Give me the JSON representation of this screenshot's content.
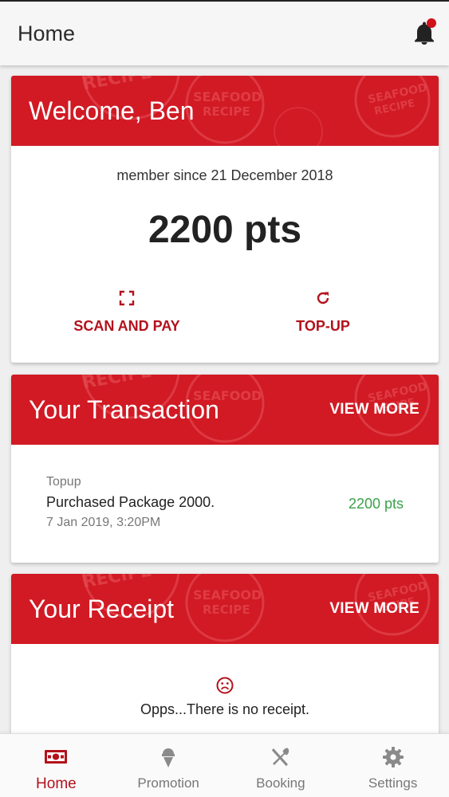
{
  "header": {
    "title": "Home",
    "bell_icon": "bell-icon",
    "notification_dot_color": "#d0111b"
  },
  "brand": {
    "primary": "#d11a24",
    "accent_text": "#b3121c",
    "positive": "#3aa14a"
  },
  "banner_pattern": {
    "text_line1": "SEAFOOD",
    "text_line2": "RECIPE"
  },
  "welcome": {
    "title": "Welcome, Ben",
    "member_since": "member since 21 December 2018",
    "points": "2200 pts",
    "actions": [
      {
        "label": "SCAN AND PAY",
        "icon": "scan-icon"
      },
      {
        "label": "TOP-UP",
        "icon": "refresh-icon"
      }
    ]
  },
  "transactions": {
    "title": "Your Transaction",
    "view_more": "VIEW MORE",
    "items": [
      {
        "type": "Topup",
        "description": "Purchased Package 2000.",
        "date": "7 Jan 2019, 3:20PM",
        "amount": "2200 pts"
      }
    ]
  },
  "receipts": {
    "title": "Your Receipt",
    "view_more": "VIEW MORE",
    "empty_message": "Opps...There is no receipt.",
    "empty_icon": "sad-face-icon"
  },
  "bottom_nav": {
    "active": "Home",
    "items": [
      {
        "label": "Home",
        "icon": "wallet-icon"
      },
      {
        "label": "Promotion",
        "icon": "ice-cream-icon"
      },
      {
        "label": "Booking",
        "icon": "utensils-icon"
      },
      {
        "label": "Settings",
        "icon": "gear-icon"
      }
    ]
  }
}
